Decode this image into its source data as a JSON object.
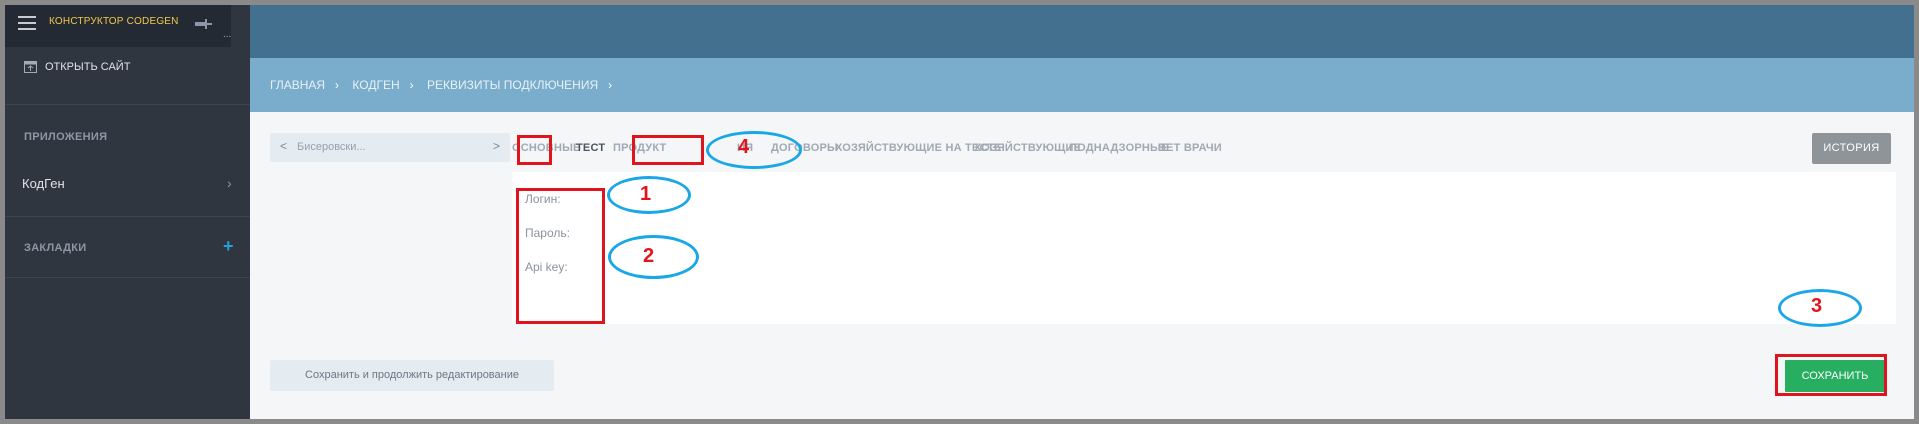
{
  "sidebar": {
    "app_title": "КОНСТРУКТОР CODEGEN",
    "more_dots": "...",
    "open_site": "ОТКРЫТЬ САЙТ",
    "apps_section": "ПРИЛОЖЕНИЯ",
    "apps_item": "КодГен",
    "bookmarks_section": "ЗАКЛАДКИ"
  },
  "breadcrumb": [
    "ГЛАВНАЯ",
    "КОДГЕН",
    "РЕКВИЗИТЫ ПОДКЛЮЧЕНИЯ"
  ],
  "object_nav": {
    "prev": "<",
    "label": "Бисеровски...",
    "next": ">"
  },
  "tabs": {
    "t0": "ОСНОВНЫЕ",
    "t1": "ТЕСТ",
    "t2": "ПРОДУКТ",
    "t3": "ИЯ",
    "t4": "ДОГОВОРЫ",
    "t5": "ХОЗЯЙСТВУЮЩИЕ НА ТЕСТЕ",
    "t6": "ХОЗЯЙСТВУЮЩИЕ",
    "t7": "ПОДНАДЗОРНЫЕ",
    "t8": "ВЕТ ВРАЧИ",
    "active": "ТЕСТ"
  },
  "history_button": "ИСТОРИЯ",
  "form": {
    "login_label": "Логин:",
    "password_label": "Пароль:",
    "apikey_label": "Api key:"
  },
  "actions": {
    "save_continue": "Сохранить и продолжить редактирование",
    "save": "СОХРАНИТЬ"
  },
  "annotations": {
    "n1": "1",
    "n2": "2",
    "n3": "3",
    "n4": "4"
  },
  "colors": {
    "sidebar_bg": "#2f3640",
    "topbar": "#43708f",
    "breadbar": "#79adcb",
    "save_green": "#27ae60",
    "annotation_red": "#e0141c",
    "annotation_blue": "#1aa7e6"
  }
}
